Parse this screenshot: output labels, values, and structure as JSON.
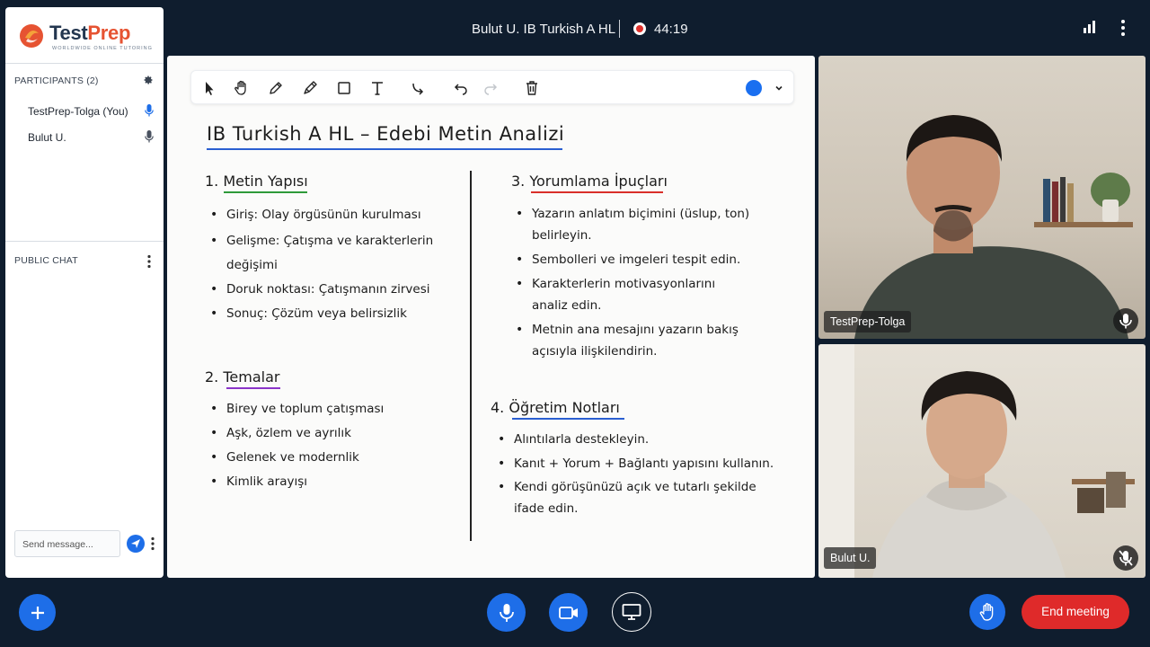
{
  "header": {
    "meeting_title": "Bulut U. IB Turkish A HL",
    "recording_time": "44:19"
  },
  "brand": {
    "name_part1": "Test",
    "name_part2": "Prep",
    "tagline": "WORLDWIDE ONLINE TUTORING"
  },
  "participants": {
    "header": "PARTICIPANTS (2)",
    "items": [
      {
        "name": "TestPrep-Tolga (You)",
        "mic": "active"
      },
      {
        "name": "Bulut U.",
        "mic": "on"
      }
    ]
  },
  "chat": {
    "header": "PUBLIC CHAT",
    "placeholder": "Send message..."
  },
  "whiteboard": {
    "title": "IB Turkish A HL – Edebi Metin Analizi",
    "sections": [
      {
        "heading": "1. Metin Yapısı",
        "bullets": [
          "Giriş: Olay örgüsünün kurulması",
          "Gelişme: Çatışma ve karakterlerin",
          "değişimi",
          "Doruk noktası: Çatışmanın zirvesi",
          "Sonuç: Çözüm veya belirsizlik"
        ]
      },
      {
        "heading": "2. Temalar",
        "bullets": [
          "Birey ve toplum çatışması",
          "Aşk, özlem ve ayrılık",
          "Gelenek ve modernlik",
          "Kimlik arayışı"
        ]
      },
      {
        "heading": "3. Yorumlama İpuçları",
        "bullets": [
          "Yazarın anlatım biçimini (üslup, ton)",
          "belirleyin.",
          "Sembolleri ve imgeleri tespit edin.",
          "Karakterlerin motivasyonlarını",
          "analiz edin.",
          "Metnin ana mesajını yazarın bakış",
          "açısıyla ilişkilendirin."
        ]
      },
      {
        "heading": "4. Öğretim Notları",
        "bullets": [
          "Alıntılarla destekleyin.",
          "Kanıt + Yorum + Bağlantı yapısını kullanın.",
          "Kendi görüşünüzü açık ve tutarlı şekilde",
          "ifade edin."
        ]
      }
    ],
    "selected_color": "#1a6ff0"
  },
  "videos": [
    {
      "name": "TestPrep-Tolga",
      "mic": "on"
    },
    {
      "name": "Bulut U.",
      "mic": "muted"
    }
  ],
  "controls": {
    "end_label": "End meeting"
  },
  "colors": {
    "accent": "#1e6ee8",
    "danger": "#df2a2a",
    "background": "#0f1d2e"
  }
}
